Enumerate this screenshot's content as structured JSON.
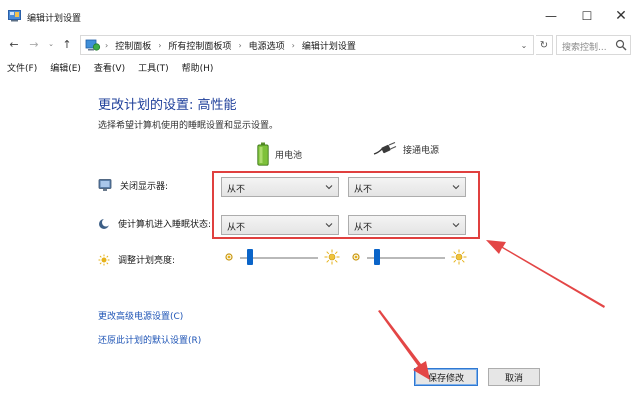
{
  "window": {
    "title": "编辑计划设置",
    "controls": {
      "minimize": "—",
      "maximize": "☐",
      "close": "✕"
    }
  },
  "nav": {
    "back": "←",
    "forward": "→",
    "recent": "⌄",
    "up": "↑",
    "breadcrumbs": [
      "控制面板",
      "所有控制面板项",
      "电源选项",
      "编辑计划设置"
    ],
    "separator": "›",
    "address_dropdown": "⌄",
    "refresh": "↻",
    "search_placeholder": "搜索控制..."
  },
  "menu": [
    "文件(F)",
    "编辑(E)",
    "查看(V)",
    "工具(T)",
    "帮助(H)"
  ],
  "content": {
    "heading": "更改计划的设置: 高性能",
    "subheading": "选择希望计算机使用的睡眠设置和显示设置。",
    "columns": {
      "battery": "用电池",
      "plugged": "接通电源"
    },
    "rows": {
      "display_off": {
        "label": "关闭显示器:",
        "battery_value": "从不",
        "plugged_value": "从不"
      },
      "sleep": {
        "label": "使计算机进入睡眠状态:",
        "battery_value": "从不",
        "plugged_value": "从不"
      },
      "brightness": {
        "label": "调整计划亮度:",
        "battery_level": 0.1,
        "plugged_level": 0.1
      }
    },
    "links": {
      "advanced": "更改高级电源设置(C)",
      "restore": "还原此计划的默认设置(R)"
    },
    "buttons": {
      "save": "保存修改",
      "cancel": "取消"
    }
  },
  "colors": {
    "heading": "#1e3f9a",
    "link": "#1f55b6",
    "annotation": "#e0403f",
    "slider_thumb": "#0a64c8"
  }
}
